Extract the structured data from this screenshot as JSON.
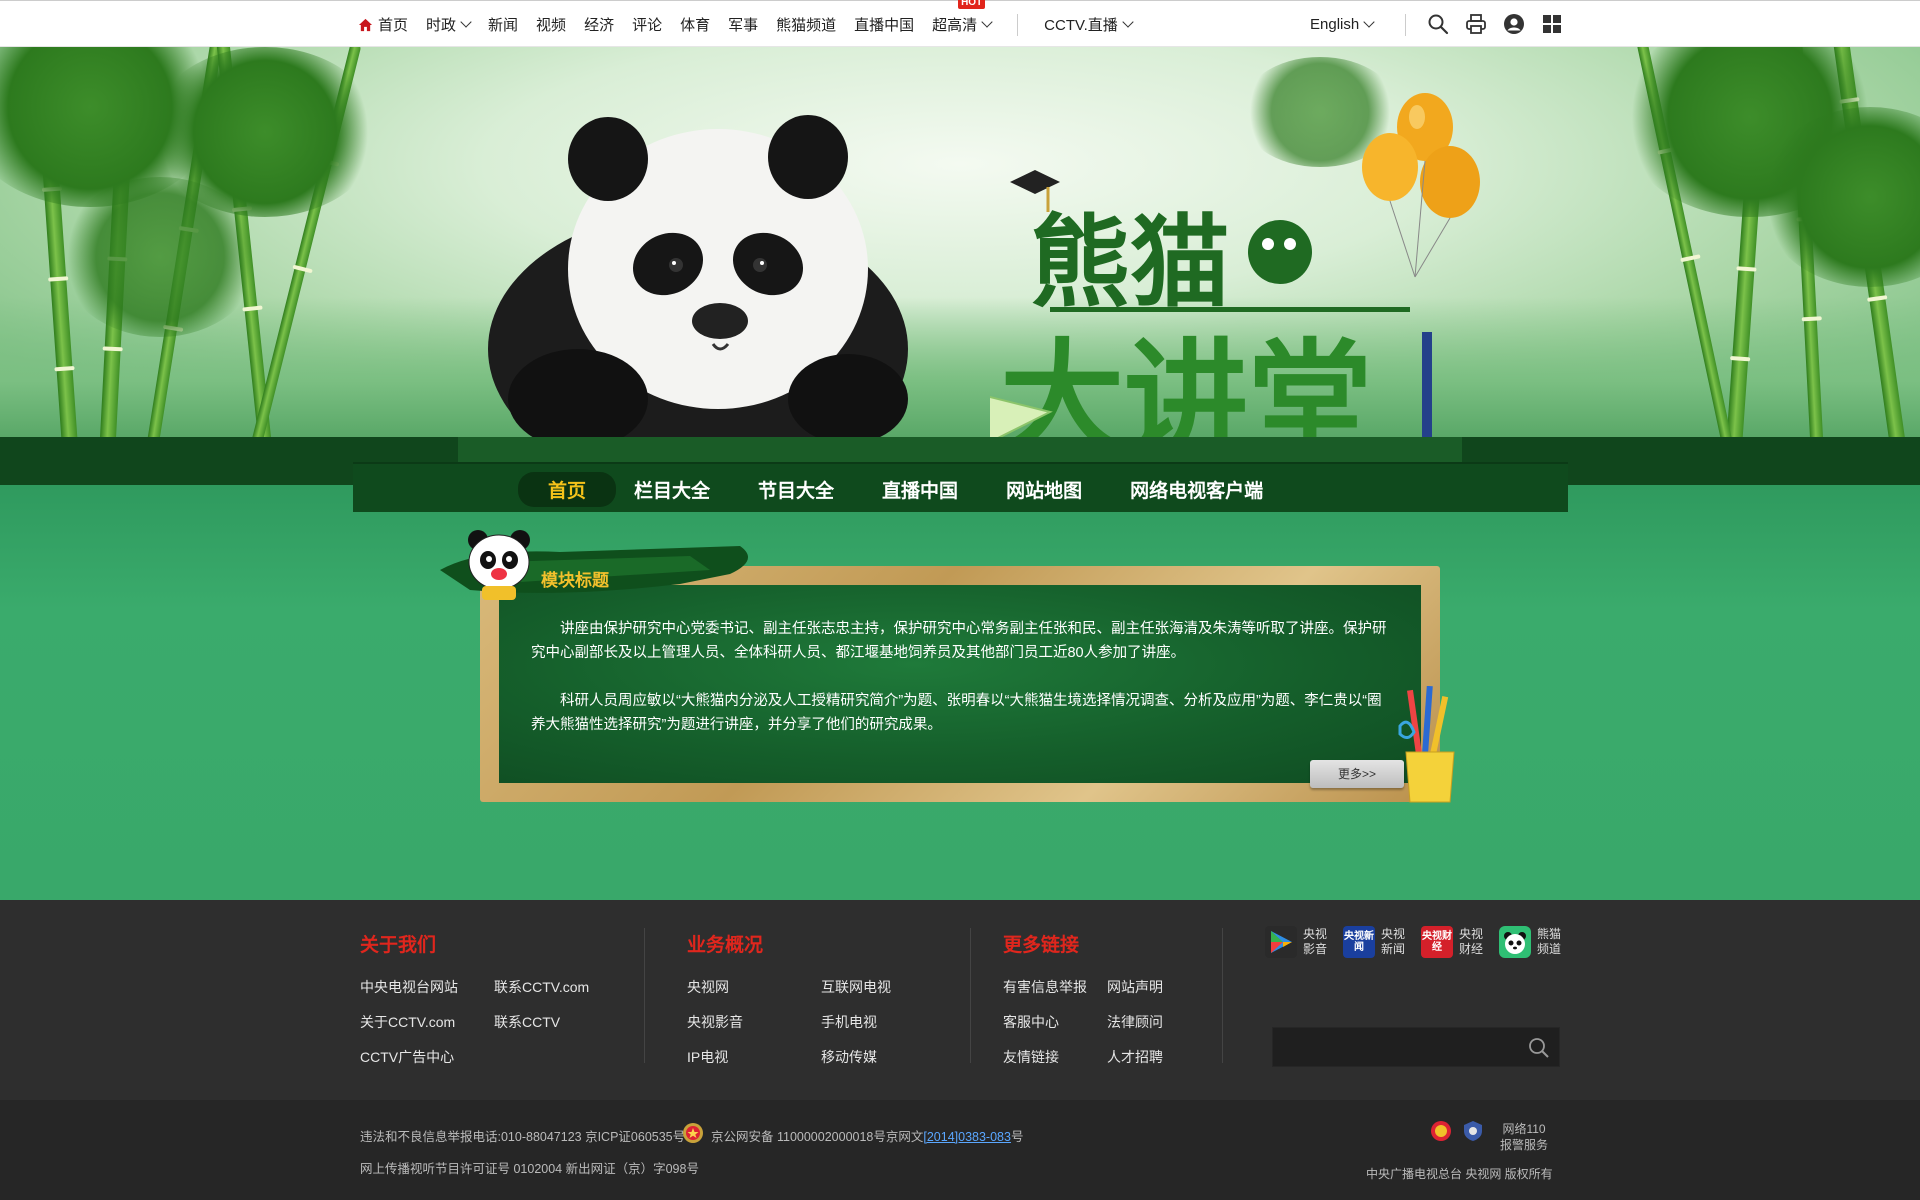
{
  "topbar": {
    "nav": [
      {
        "label": "首页",
        "icon": "home-icon",
        "has_dropdown": false
      },
      {
        "label": "时政",
        "has_dropdown": true
      },
      {
        "label": "新闻",
        "has_dropdown": false
      },
      {
        "label": "视频",
        "has_dropdown": false
      },
      {
        "label": "经济",
        "has_dropdown": false
      },
      {
        "label": "评论",
        "has_dropdown": false
      },
      {
        "label": "体育",
        "has_dropdown": false
      },
      {
        "label": "军事",
        "has_dropdown": false
      },
      {
        "label": "熊猫频道",
        "has_dropdown": false
      },
      {
        "label": "直播中国",
        "has_dropdown": false
      },
      {
        "label": "超高清",
        "has_dropdown": true,
        "badge": "HOT"
      },
      {
        "label": "CCTV.直播",
        "has_dropdown": true
      }
    ],
    "language": "English",
    "tools": [
      "search-icon",
      "print-icon",
      "user-icon",
      "grid-apps-icon"
    ],
    "accent_color": "#c8161d"
  },
  "banner": {
    "title_line1": "熊猫",
    "title_line2": "大讲堂"
  },
  "main_nav": {
    "items": [
      {
        "label": "首页",
        "active": true
      },
      {
        "label": "栏目大全",
        "active": false
      },
      {
        "label": "节目大全",
        "active": false
      },
      {
        "label": "直播中国",
        "active": false
      },
      {
        "label": "网站地图",
        "active": false
      },
      {
        "label": "网络电视客户端",
        "active": false
      }
    ],
    "active_color": "#f5c31a"
  },
  "module": {
    "title": "模块标题",
    "paragraph1": "讲座由保护研究中心党委书记、副主任张志忠主持，保护研究中心常务副主任张和民、副主任张海清及朱涛等听取了讲座。保护研究中心副部长及以上管理人员、全体科研人员、都江堰基地饲养员及其他部门员工近80人参加了讲座。",
    "paragraph2": "科研人员周应敏以“大熊猫内分泌及人工授精研究简介”为题、张明春以“大熊猫生境选择情况调查、分析及应用”为题、李仁贵以“圈养大熊猫性选择研究”为题进行讲座，并分享了他们的研究成果。",
    "more_label": "更多>>"
  },
  "footer": {
    "columns": [
      {
        "title": "关于我们",
        "links": [
          "中央电视台网站",
          "联系CCTV.com",
          "关于CCTV.com",
          "联系CCTV",
          "CCTV广告中心"
        ]
      },
      {
        "title": "业务概况",
        "links": [
          "央视网",
          "互联网电视",
          "央视影音",
          "手机电视",
          "IP电视",
          "移动传媒"
        ]
      },
      {
        "title": "更多链接",
        "links": [
          "有害信息举报",
          "网站声明",
          "客服中心",
          "法律顾问",
          "友情链接",
          "人才招聘"
        ]
      }
    ],
    "apps": [
      {
        "line1": "央视",
        "line2": "影音",
        "icon": "cctv-video-app-icon"
      },
      {
        "line1": "央视",
        "line2": "新闻",
        "icon": "cctv-news-app-icon",
        "icon_text": "央视新闻"
      },
      {
        "line1": "央视",
        "line2": "财经",
        "icon": "cctv-finance-app-icon",
        "icon_text": "央视财经"
      },
      {
        "line1": "熊猫",
        "line2": "频道",
        "icon": "panda-channel-app-icon"
      }
    ],
    "search_placeholder": "",
    "title_color": "#e0261d"
  },
  "bottom": {
    "line1_a": "违法和不良信息举报电话:010-88047123 京ICP证060535号",
    "line1_b_prefix": "京公网安备 11000002000018号京网文",
    "line1_b_link": "[2014]0383-083",
    "line1_b_suffix": "号",
    "line2": "网上传播视听节目许可证号 0102004 新出网证（京）字098号",
    "report_line1": "网络110",
    "report_line2": "报警服务",
    "copyright": "中央广播电视总台  央视网  版权所有"
  }
}
